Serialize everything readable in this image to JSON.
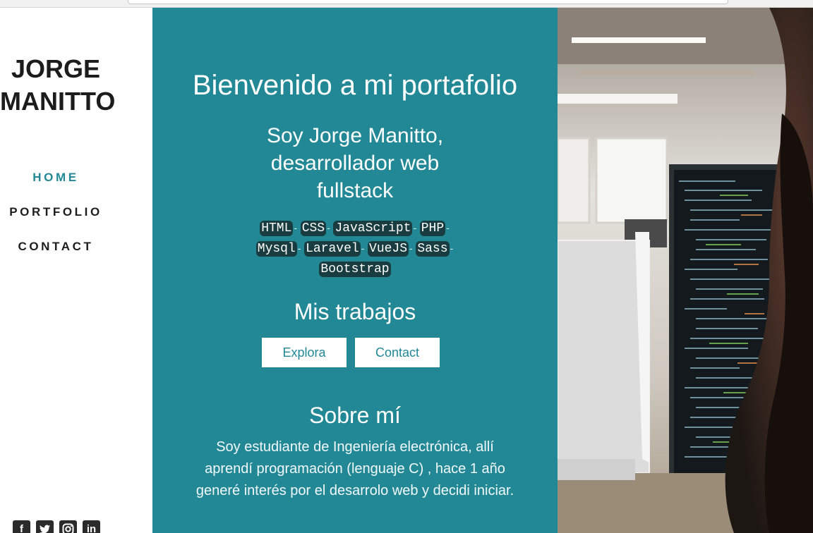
{
  "sidebar": {
    "brand_line1": "JORGE",
    "brand_line2": "MANITTO",
    "nav": {
      "home": "HOME",
      "portfolio": "PORTFOLIO",
      "contact": "CONTACT"
    },
    "socials": [
      "facebook",
      "twitter",
      "instagram",
      "linkedin"
    ]
  },
  "main": {
    "title": "Bienvenido a mi portafolio",
    "intro_line1": "Soy Jorge Manitto,",
    "intro_line2": "desarrollador web",
    "intro_line3": "fullstack",
    "skills": [
      "HTML",
      "CSS",
      "JavaScript",
      "PHP",
      "Mysql",
      "Laravel",
      "VueJS",
      "Sass",
      "Bootstrap"
    ],
    "skill_separator": "-",
    "works_heading": "Mis trabajos",
    "explore_button": "Explora",
    "contact_button": "Contact",
    "about_heading": "Sobre mí",
    "about_text": "Soy estudiante de Ingeniería electrónica, allí aprendí programación (lenguaje C) , hace 1 año generé interés por el desarrolo web y decidi iniciar."
  },
  "colors": {
    "accent": "#228896",
    "skill_badge": "#183c3f",
    "sidebar_text": "#1d1d1d"
  }
}
